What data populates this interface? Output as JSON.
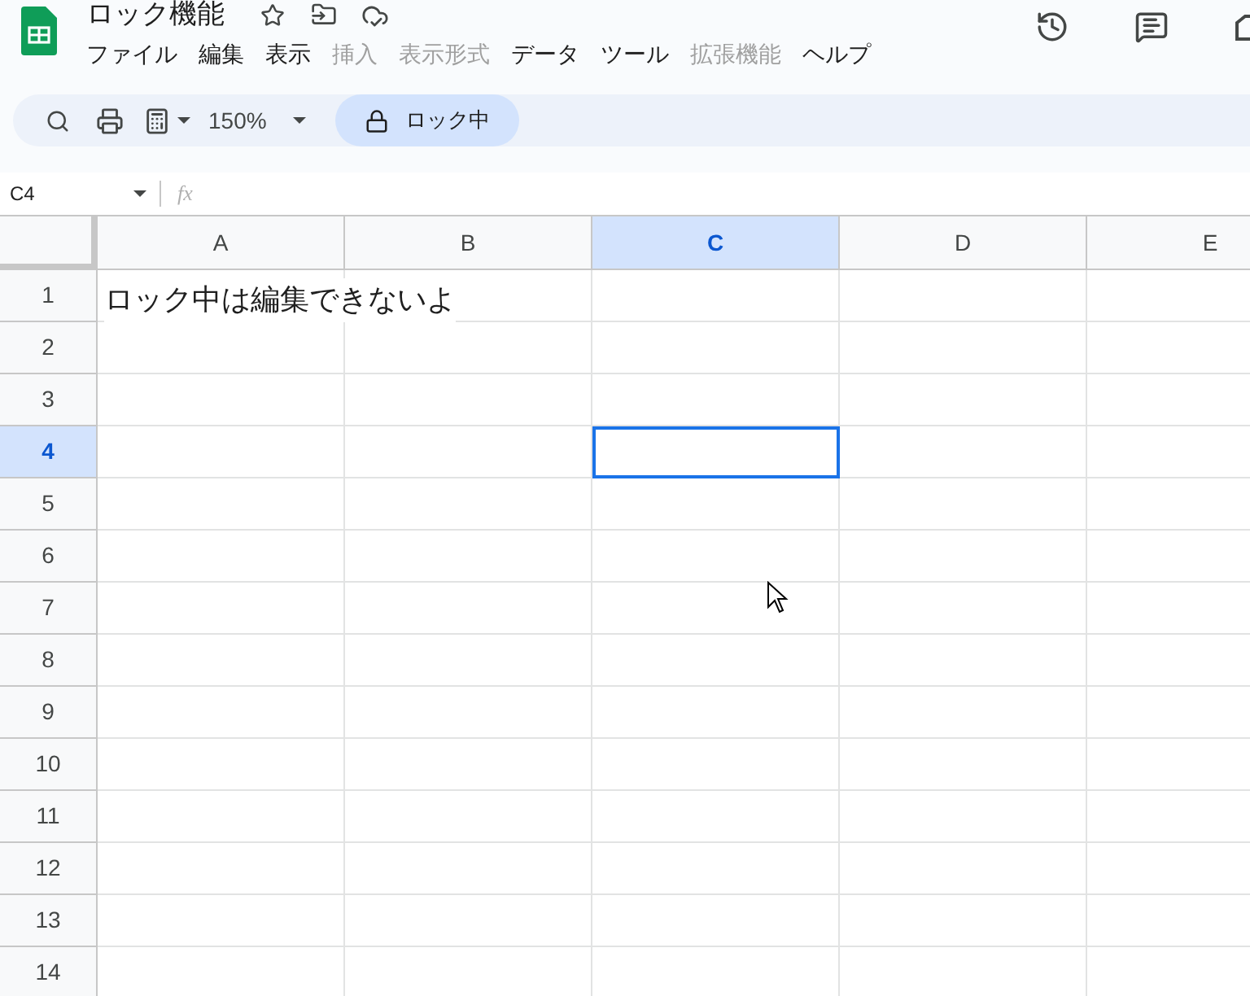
{
  "title": "ロック機能",
  "menu": [
    {
      "label": "ファイル",
      "disabled": false
    },
    {
      "label": "編集",
      "disabled": false
    },
    {
      "label": "表示",
      "disabled": false
    },
    {
      "label": "挿入",
      "disabled": true
    },
    {
      "label": "表示形式",
      "disabled": true
    },
    {
      "label": "データ",
      "disabled": false
    },
    {
      "label": "ツール",
      "disabled": false
    },
    {
      "label": "拡張機能",
      "disabled": true
    },
    {
      "label": "ヘルプ",
      "disabled": false
    }
  ],
  "toolbar": {
    "zoom": "150%",
    "lock_label": "ロック中"
  },
  "formula_bar": {
    "name_box": "C4",
    "fx": "fx"
  },
  "columns": [
    {
      "label": "A",
      "selected": false
    },
    {
      "label": "B",
      "selected": false
    },
    {
      "label": "C",
      "selected": true
    },
    {
      "label": "D",
      "selected": false
    },
    {
      "label": "E",
      "selected": false
    }
  ],
  "rows": [
    {
      "label": "1",
      "selected": false,
      "cells": [
        {
          "text": "ロック中は編集できないよ"
        }
      ]
    },
    {
      "label": "2",
      "selected": false
    },
    {
      "label": "3",
      "selected": false
    },
    {
      "label": "4",
      "selected": true
    },
    {
      "label": "5",
      "selected": false
    },
    {
      "label": "6",
      "selected": false
    },
    {
      "label": "7",
      "selected": false
    },
    {
      "label": "8",
      "selected": false
    },
    {
      "label": "9",
      "selected": false
    },
    {
      "label": "10",
      "selected": false
    },
    {
      "label": "11",
      "selected": false
    },
    {
      "label": "12",
      "selected": false
    },
    {
      "label": "13",
      "selected": false
    },
    {
      "label": "14",
      "selected": false
    }
  ]
}
